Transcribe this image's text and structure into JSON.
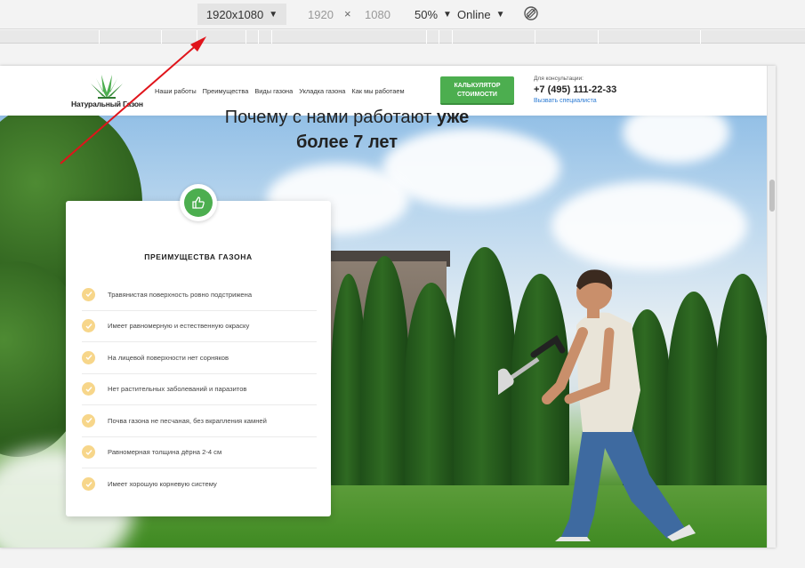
{
  "devtools": {
    "device": "1920x1080",
    "width": "1920",
    "times": "×",
    "height": "1080",
    "zoom": "50%",
    "network": "Online",
    "caret": "▼",
    "icons": {
      "rotate": "rotate-icon",
      "dropdown": "caret-down-icon"
    }
  },
  "header": {
    "logo_text": "Натуральный Газон",
    "nav": [
      "Наши работы",
      "Преимущества",
      "Виды газона",
      "Укладка газона",
      "Как мы работаем"
    ],
    "cta_line1": "КАЛЬКУЛЯТОР",
    "cta_line2": "СТОИМОСТИ",
    "consult_label": "Для консультации:",
    "phone": "+7 (495) 111-22-33",
    "call_link": "Вызвать специалиста"
  },
  "headline": {
    "line1": "Почему с нами работают ",
    "line1_bold": "уже",
    "line2": "более 7 лет"
  },
  "card": {
    "badge_icon": "thumbs-up-icon",
    "title": "ПРЕИМУЩЕСТВА ГАЗОНА",
    "items": [
      "Травянистая поверхность ровно подстрижена",
      "Имеет равномерную и естественную окраску",
      "На лицевой поверхности нет сорняков",
      "Нет растительных заболеваний и паразитов",
      "Почва газона не песчаная, без вкрапления камней",
      "Равномерная толщина дёрна 2-4 см",
      "Имеет хорошую корневую систему"
    ]
  },
  "colors": {
    "accent_green": "#4cae4f",
    "check_yellow": "#f7d68a",
    "annotation_arrow": "#e0141b",
    "link_blue": "#2a7ad3"
  }
}
